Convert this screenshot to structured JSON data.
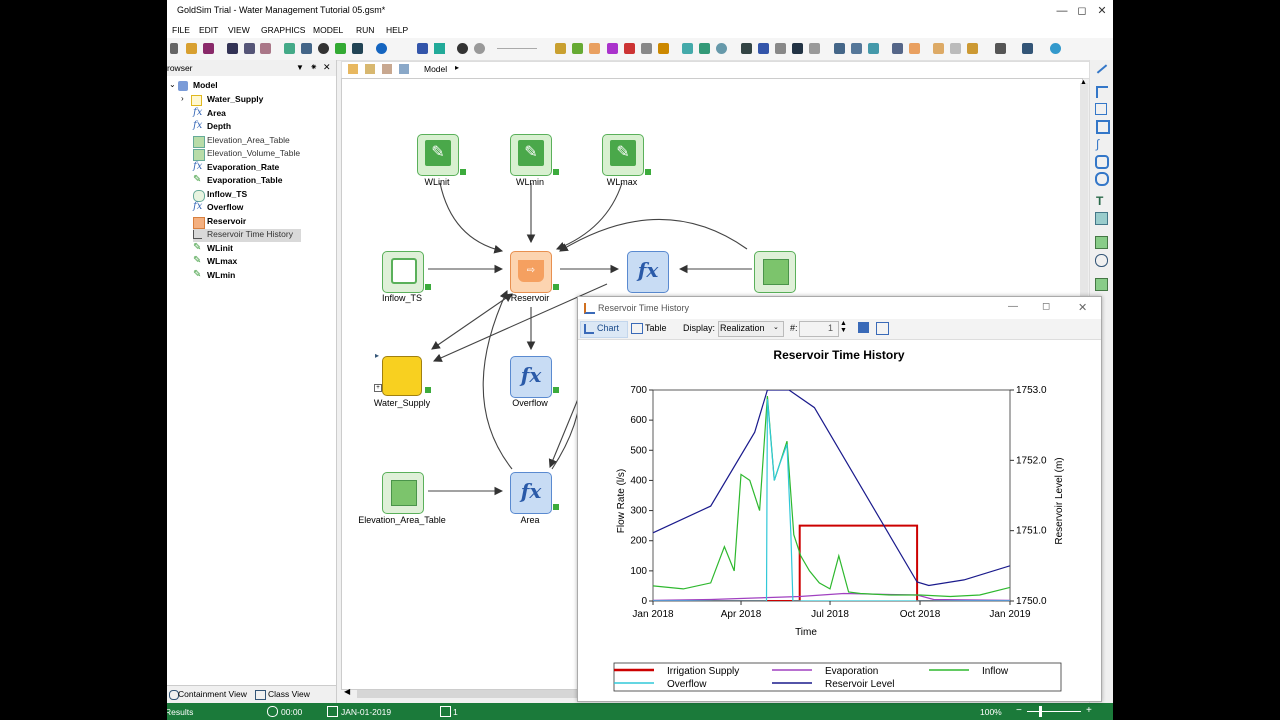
{
  "window": {
    "title": "GoldSim  Trial  - Water Management Tutorial 05.gsm*"
  },
  "menu": [
    "FILE",
    "EDIT",
    "VIEW",
    "GRAPHICS",
    "MODEL",
    "RUN",
    "HELP"
  ],
  "browser": {
    "header": "rowser",
    "root": "Model",
    "items": [
      {
        "label": "Water_Supply",
        "bold": true,
        "icon": "container-icon"
      },
      {
        "label": "Area",
        "bold": true,
        "icon": "function-icon"
      },
      {
        "label": "Depth",
        "bold": true,
        "icon": "function-icon"
      },
      {
        "label": "Elevation_Area_Table",
        "bold": false,
        "icon": "table-icon"
      },
      {
        "label": "Elevation_Volume_Table",
        "bold": false,
        "icon": "table-icon"
      },
      {
        "label": "Evaporation_Rate",
        "bold": true,
        "icon": "function-icon"
      },
      {
        "label": "Evaporation_Table",
        "bold": true,
        "icon": "data-icon"
      },
      {
        "label": "Inflow_TS",
        "bold": true,
        "icon": "timeseries-icon"
      },
      {
        "label": "Overflow",
        "bold": true,
        "icon": "function-icon"
      },
      {
        "label": "Reservoir",
        "bold": true,
        "icon": "reservoir-icon"
      },
      {
        "label": "Reservoir Time History",
        "bold": false,
        "icon": "chart-icon"
      },
      {
        "label": "WLinit",
        "bold": true,
        "icon": "data-icon"
      },
      {
        "label": "WLmax",
        "bold": true,
        "icon": "data-icon"
      },
      {
        "label": "WLmin",
        "bold": true,
        "icon": "data-icon"
      }
    ],
    "tabs": [
      "Containment View",
      "Class View"
    ]
  },
  "path": {
    "label": "Model"
  },
  "nodes": {
    "wlinit": "WLinit",
    "wlmin": "WLmin",
    "wlmax": "WLmax",
    "inflow": "Inflow_TS",
    "reservoir": "Reservoir",
    "depth": "Depth",
    "elev_vol": "Elevation_Volume_Table",
    "water_supply": "Water_Supply",
    "overflow": "Overflow",
    "elev_area": "Elevation_Area_Table",
    "area": "Area"
  },
  "status": {
    "left": "Results",
    "time": "00:00",
    "date": "JAN-01-2019",
    "count": "1",
    "zoom": "100%"
  },
  "popup": {
    "title": "Reservoir Time History",
    "chart_tab": "Chart",
    "table_tab": "Table",
    "display_label": "Display:",
    "display_value": "Realization",
    "num_label": "#:",
    "num_value": "1"
  },
  "chart_data": {
    "type": "line",
    "title": "Reservoir Time History",
    "xlabel": "Time",
    "ylabel": "Flow Rate (l/s)",
    "y2label": "Reservoir Level (m)",
    "xticks": [
      "Jan 2018",
      "Apr 2018",
      "Jul 2018",
      "Oct 2018",
      "Jan 2019"
    ],
    "yticks": [
      "0",
      "100",
      "200",
      "300",
      "400",
      "500",
      "600",
      "700"
    ],
    "y2ticks": [
      "1750.0",
      "1751.0",
      "1752.0",
      "1753.0"
    ],
    "ylim": [
      0,
      700
    ],
    "y2lim": [
      1750,
      1753
    ],
    "grid": false,
    "legend_position": "bottom",
    "series": [
      {
        "name": "Irrigation Supply",
        "color": "#cc0000",
        "axis": "left",
        "x": [
          "2018-01-01",
          "2018-05-31",
          "2018-05-31",
          "2018-09-28",
          "2018-09-28",
          "2019-01-01"
        ],
        "y": [
          0,
          0,
          250,
          250,
          0,
          0
        ]
      },
      {
        "name": "Evaporation",
        "color": "#a040c0",
        "axis": "left",
        "x": [
          "2018-01-01",
          "2018-03-01",
          "2018-04-15",
          "2018-05-31",
          "2018-07-15",
          "2018-09-28",
          "2018-10-15",
          "2019-01-01"
        ],
        "y": [
          2,
          5,
          10,
          15,
          25,
          20,
          5,
          2
        ]
      },
      {
        "name": "Inflow",
        "color": "#2eb82e",
        "axis": "left",
        "x": [
          "2018-01-01",
          "2018-02-01",
          "2018-03-01",
          "2018-03-15",
          "2018-03-25",
          "2018-04-01",
          "2018-04-10",
          "2018-04-20",
          "2018-04-28",
          "2018-05-05",
          "2018-05-10",
          "2018-05-18",
          "2018-05-25",
          "2018-06-01",
          "2018-06-10",
          "2018-06-20",
          "2018-07-01",
          "2018-07-10",
          "2018-07-20",
          "2018-08-01",
          "2018-09-01",
          "2018-10-01",
          "2018-11-01",
          "2018-12-01",
          "2019-01-01"
        ],
        "y": [
          50,
          40,
          60,
          180,
          100,
          420,
          400,
          300,
          680,
          400,
          450,
          530,
          220,
          150,
          100,
          60,
          40,
          150,
          30,
          25,
          20,
          20,
          15,
          20,
          45
        ]
      },
      {
        "name": "Overflow",
        "color": "#30c8d8",
        "axis": "left",
        "x": [
          "2018-01-01",
          "2018-04-27",
          "2018-04-28",
          "2018-05-05",
          "2018-05-10",
          "2018-05-18",
          "2018-05-22",
          "2018-05-24",
          "2019-01-01"
        ],
        "y": [
          0,
          0,
          670,
          400,
          450,
          520,
          220,
          0,
          0
        ]
      },
      {
        "name": "Reservoir Level",
        "color": "#1a1a8c",
        "axis": "right",
        "x": [
          "2018-01-01",
          "2018-03-01",
          "2018-04-15",
          "2018-04-28",
          "2018-05-20",
          "2018-06-15",
          "2018-09-28",
          "2018-10-10",
          "2018-11-15",
          "2019-01-01"
        ],
        "y": [
          1750.97,
          1751.35,
          1752.4,
          1753.0,
          1753.0,
          1752.75,
          1750.27,
          1750.22,
          1750.3,
          1750.5
        ]
      }
    ]
  }
}
